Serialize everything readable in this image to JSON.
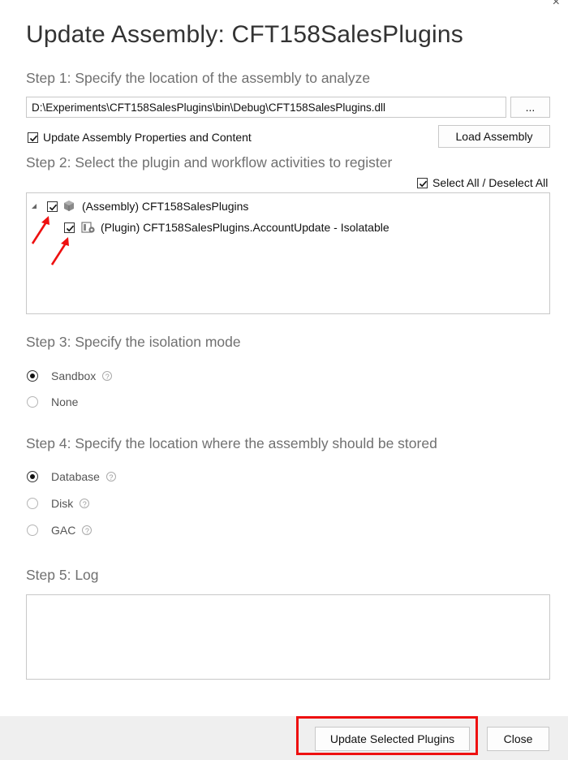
{
  "window": {
    "close_glyph": "×",
    "title": "Update Assembly: CFT158SalesPlugins"
  },
  "step1": {
    "label": "Step 1: Specify the location of the assembly to analyze",
    "path_value": "D:\\Experiments\\CFT158SalesPlugins\\bin\\Debug\\CFT158SalesPlugins.dll",
    "browse_label": "...",
    "update_props_label": "Update Assembly Properties and Content",
    "update_props_checked": true,
    "load_label": "Load Assembly"
  },
  "step2": {
    "label": "Step 2: Select the plugin and workflow activities to register",
    "select_all_label": "Select All / Deselect All",
    "select_all_checked": true,
    "tree": [
      {
        "label": "(Assembly) CFT158SalesPlugins",
        "checked": true,
        "icon": "assembly-icon"
      },
      {
        "label": "(Plugin) CFT158SalesPlugins.AccountUpdate - Isolatable",
        "checked": true,
        "icon": "plugin-icon"
      }
    ]
  },
  "step3": {
    "label": "Step 3: Specify the isolation mode",
    "options": [
      {
        "label": "Sandbox",
        "selected": true,
        "help": "?"
      },
      {
        "label": "None",
        "selected": false
      }
    ]
  },
  "step4": {
    "label": "Step 4: Specify the location where the assembly should be stored",
    "options": [
      {
        "label": "Database",
        "selected": true,
        "help": "?"
      },
      {
        "label": "Disk",
        "selected": false,
        "help": "?"
      },
      {
        "label": "GAC",
        "selected": false,
        "help": "?"
      }
    ]
  },
  "step5": {
    "label": "Step 5: Log",
    "log_text": ""
  },
  "footer": {
    "update_label": "Update Selected Plugins",
    "close_label": "Close"
  },
  "colors": {
    "annotation_red": "#ee1010",
    "step_gray": "#707070"
  }
}
